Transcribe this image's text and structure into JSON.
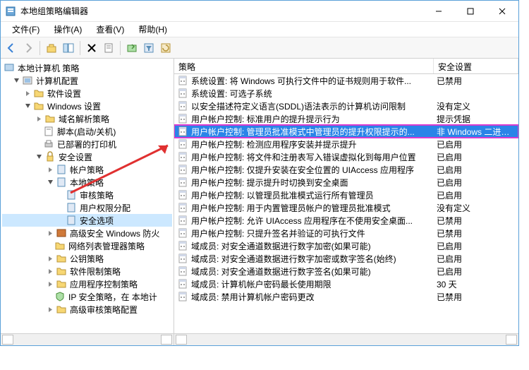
{
  "window": {
    "title": "本地组策略编辑器"
  },
  "menu": {
    "file": "文件(F)",
    "action": "操作(A)",
    "view": "查看(V)",
    "help": "帮助(H)"
  },
  "tree": {
    "root": "本地计算机 策略",
    "computer_config": "计算机配置",
    "software_settings": "软件设置",
    "windows_settings": "Windows 设置",
    "dns_policy": "域名解析策略",
    "startup_scripts": "脚本(启动/关机)",
    "deployed_printers": "已部署的打印机",
    "security_settings": "安全设置",
    "account_policy": "帐户策略",
    "local_policy": "本地策略",
    "audit_policy": "审核策略",
    "user_rights": "用户权限分配",
    "security_options": "安全选项",
    "adv_firewall": "高级安全 Windows 防火",
    "nlm_policy": "网络列表管理器策略",
    "pki_policy": "公钥策略",
    "software_restriction": "软件限制策略",
    "app_control": "应用程序控制策略",
    "ipsec": "IP 安全策略，在 本地计",
    "adv_audit": "高级审核策略配置"
  },
  "list": {
    "col_policy": "策略",
    "col_setting": "安全设置",
    "rows": [
      {
        "p": "系统设置: 将 Windows 可执行文件中的证书规则用于软件...",
        "s": "已禁用"
      },
      {
        "p": "系统设置: 可选子系统",
        "s": ""
      },
      {
        "p": "以安全描述符定义语言(SDDL)语法表示的计算机访问限制",
        "s": "没有定义"
      },
      {
        "p": "用户帐户控制: 标准用户的提升提示行为",
        "s": "提示凭据"
      },
      {
        "p": "用户帐户控制: 管理员批准模式中管理员的提升权限提示的...",
        "s": "非 Windows 二进制文"
      },
      {
        "p": "用户帐户控制: 检测应用程序安装并提示提升",
        "s": "已启用"
      },
      {
        "p": "用户帐户控制: 将文件和注册表写入错误虚拟化到每用户位置",
        "s": "已启用"
      },
      {
        "p": "用户帐户控制: 仅提升安装在安全位置的 UIAccess 应用程序",
        "s": "已启用"
      },
      {
        "p": "用户帐户控制: 提示提升时切换到安全桌面",
        "s": "已启用"
      },
      {
        "p": "用户帐户控制: 以管理员批准模式运行所有管理员",
        "s": "已启用"
      },
      {
        "p": "用户帐户控制: 用于内置管理员帐户的管理员批准模式",
        "s": "没有定义"
      },
      {
        "p": "用户帐户控制: 允许 UIAccess 应用程序在不使用安全桌面...",
        "s": "已禁用"
      },
      {
        "p": "用户帐户控制: 只提升签名并验证的可执行文件",
        "s": "已禁用"
      },
      {
        "p": "域成员: 对安全通道数据进行数字加密(如果可能)",
        "s": "已启用"
      },
      {
        "p": "域成员: 对安全通道数据进行数字加密或数字签名(始终)",
        "s": "已启用"
      },
      {
        "p": "域成员: 对安全通道数据进行数字签名(如果可能)",
        "s": "已启用"
      },
      {
        "p": "域成员: 计算机帐户密码最长使用期限",
        "s": "30 天"
      },
      {
        "p": "域成员: 禁用计算机帐户密码更改",
        "s": "已禁用"
      }
    ]
  }
}
